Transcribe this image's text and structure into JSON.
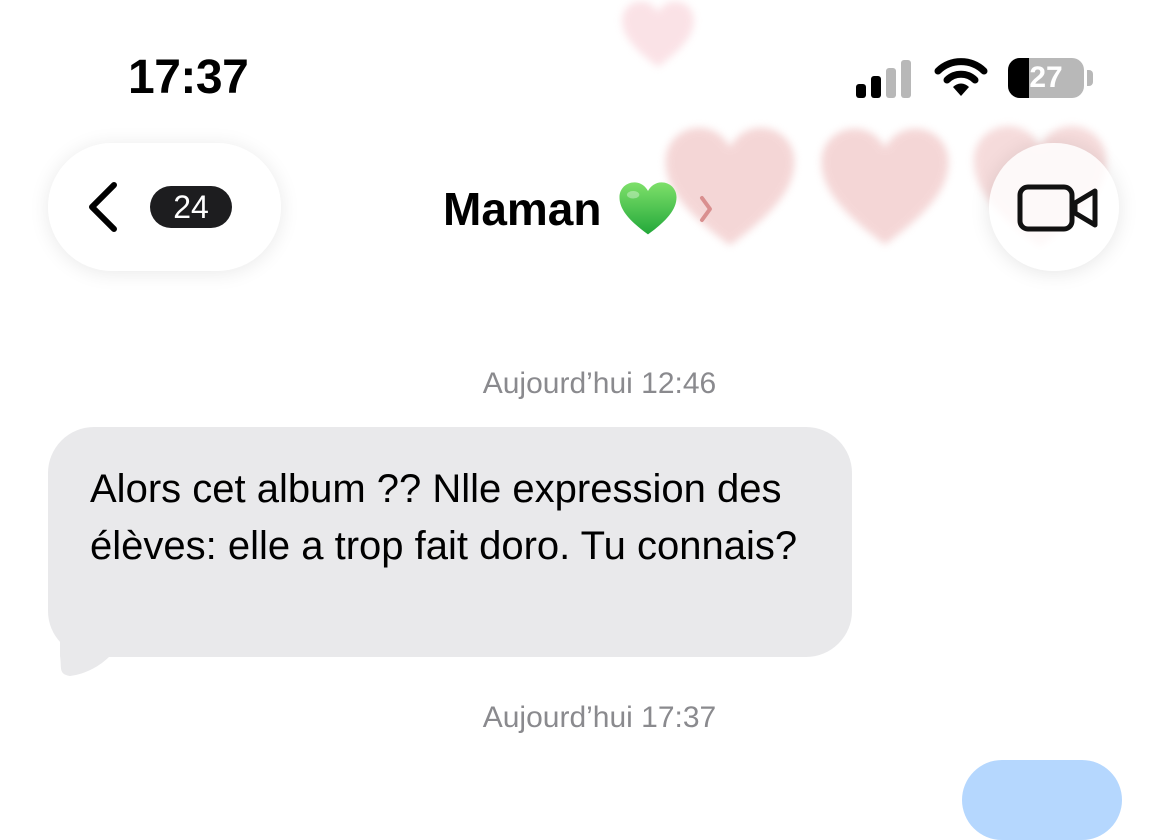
{
  "colors": {
    "bubble_incoming": "#e9e9eb",
    "timestamp": "#8a8a8e",
    "badge_bg": "#1d1d1f",
    "accent_heart": "#34c759",
    "outgoing_peek": "#2a8cfb"
  },
  "status_bar": {
    "time": "17:37",
    "signal_icon": "cellular-signal-icon",
    "signal_bars_active": 2,
    "signal_bars_total": 4,
    "wifi_icon": "wifi-icon",
    "battery_icon": "battery-icon",
    "battery_level": "27",
    "battery_fraction": 0.27
  },
  "header": {
    "back_icon": "chevron-left-icon",
    "unread_count": "24",
    "contact_name": "Maman",
    "contact_emoji_icon": "green-heart-icon",
    "contact_chevron_icon": "chevron-right-icon",
    "video_icon": "video-camera-icon"
  },
  "conversation": {
    "timestamp_1": "Aujourd’hui 12:46",
    "message_1": "Alors cet album ?? Nlle expression des élèves: elle a trop fait doro. Tu connais?",
    "timestamp_2": "Aujourd’hui 17:37"
  }
}
